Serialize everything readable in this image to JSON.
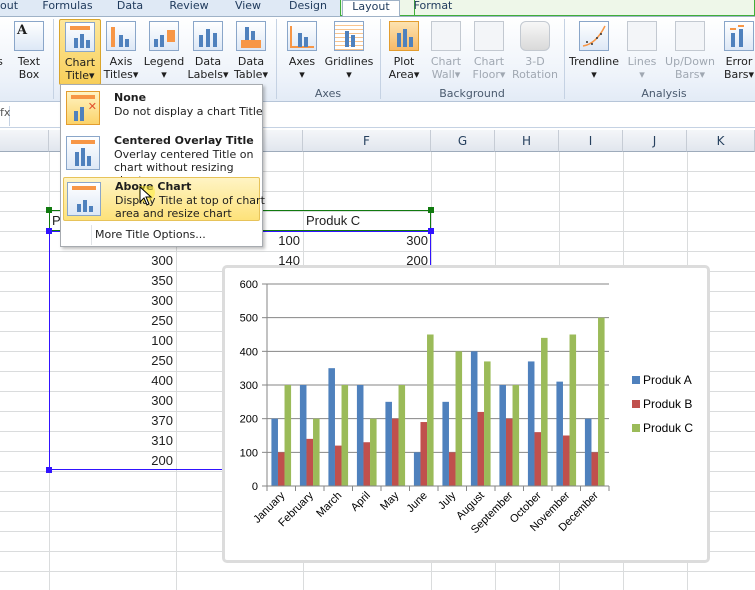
{
  "tabs": [
    {
      "label": "out",
      "active": false
    },
    {
      "label": "Formulas",
      "active": false
    },
    {
      "label": "Data",
      "active": false
    },
    {
      "label": "Review",
      "active": false
    },
    {
      "label": "View",
      "active": false
    },
    {
      "label": "Design",
      "active": false,
      "contextual": true
    },
    {
      "label": "Layout",
      "active": true,
      "contextual": true
    },
    {
      "label": "Format",
      "active": false,
      "contextual": true
    }
  ],
  "ribbon": {
    "insert_partial": {
      "label_line2": "s"
    },
    "text_box": {
      "line1": "Text",
      "line2": "Box"
    },
    "labels_group": [
      {
        "line1": "Chart",
        "line2": "Title",
        "dropdown": true,
        "pressed": true
      },
      {
        "line1": "Axis",
        "line2": "Titles",
        "dropdown": true
      },
      {
        "line1": "Legend",
        "line2": "",
        "dropdown": true
      },
      {
        "line1": "Data",
        "line2": "Labels",
        "dropdown": true
      },
      {
        "line1": "Data",
        "line2": "Table",
        "dropdown": true
      }
    ],
    "axes_group": {
      "label": "Axes",
      "buttons": [
        {
          "line1": "Axes",
          "dropdown": true
        },
        {
          "line1": "Gridlines",
          "dropdown": true
        }
      ]
    },
    "background_group": {
      "label": "Background",
      "buttons": [
        {
          "line1": "Plot",
          "line2": "Area",
          "dropdown": true,
          "disabled": false
        },
        {
          "line1": "Chart",
          "line2": "Wall",
          "dropdown": true,
          "disabled": true
        },
        {
          "line1": "Chart",
          "line2": "Floor",
          "dropdown": true,
          "disabled": true
        },
        {
          "line1": "3-D",
          "line2": "Rotation",
          "dropdown": false,
          "disabled": true
        }
      ]
    },
    "analysis_group": {
      "label": "Analysis",
      "buttons": [
        {
          "line1": "Trendline",
          "dropdown": true,
          "disabled": false
        },
        {
          "line1": "Lines",
          "dropdown": true,
          "disabled": true
        },
        {
          "line1": "Up/Down",
          "line2": "Bars",
          "dropdown": true,
          "disabled": true
        },
        {
          "line1": "Error",
          "line2": "Bars",
          "dropdown": true,
          "disabled": false
        }
      ]
    },
    "dropdown_arrow": "▾"
  },
  "formula_bar": {
    "fx_glyph": "fx",
    "value": ""
  },
  "columns": [
    "F",
    "G",
    "H",
    "I",
    "J",
    "K"
  ],
  "chart_title_menu": {
    "items": [
      {
        "title": "None",
        "description": "Do not display a chart Title",
        "state": "selected"
      },
      {
        "title": "Centered Overlay Title",
        "description": "Overlay centered Title on chart without resizing chart",
        "state": "normal"
      },
      {
        "title": "Above Chart",
        "description": "Display Title at top of chart area and resize chart",
        "state": "hover"
      }
    ],
    "more_options": "More Title Options..."
  },
  "sheet": {
    "header_partial": "P",
    "header_c": "Produk C",
    "row1": {
      "b": "100",
      "c": "300"
    },
    "row2": {
      "b": "140",
      "c": "200"
    },
    "col_a_values": [
      "300",
      "350",
      "300",
      "250",
      "100",
      "250",
      "400",
      "300",
      "370",
      "310",
      "200"
    ]
  },
  "chart_data": {
    "type": "bar",
    "title": "",
    "xlabel": "",
    "ylabel": "",
    "categories": [
      "January",
      "February",
      "March",
      "April",
      "May",
      "June",
      "July",
      "August",
      "September",
      "October",
      "November",
      "December"
    ],
    "series": [
      {
        "name": "Produk A",
        "color": "#4f81bd",
        "values": [
          200,
          300,
          350,
          300,
          250,
          100,
          250,
          400,
          300,
          370,
          310,
          200
        ]
      },
      {
        "name": "Produk B",
        "color": "#c0504d",
        "values": [
          100,
          140,
          120,
          130,
          200,
          190,
          100,
          220,
          200,
          160,
          150,
          100
        ]
      },
      {
        "name": "Produk C",
        "color": "#9bbb59",
        "values": [
          300,
          200,
          300,
          200,
          300,
          450,
          400,
          370,
          300,
          440,
          450,
          500
        ]
      }
    ],
    "ylim": [
      0,
      600
    ],
    "yticks": [
      0,
      100,
      200,
      300,
      400,
      500,
      600
    ],
    "grid": true,
    "legend": "right"
  }
}
